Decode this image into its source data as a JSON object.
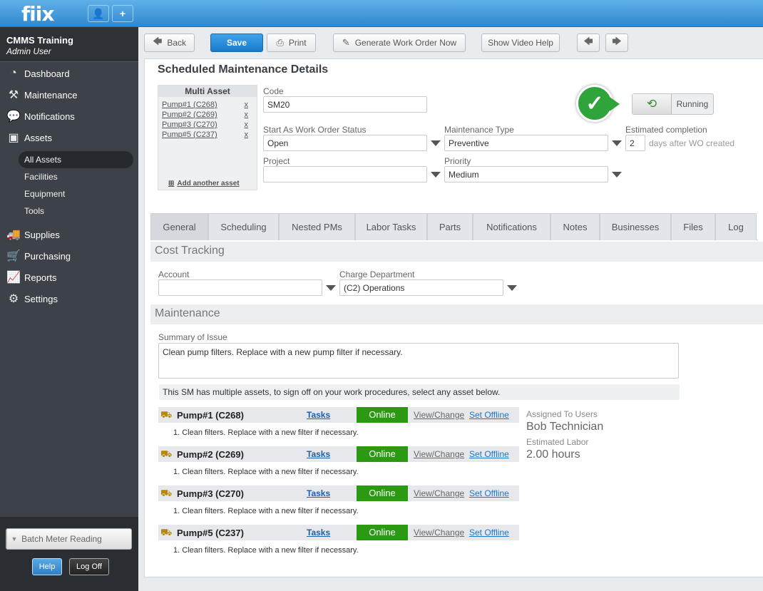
{
  "app": {
    "logo": "fiix"
  },
  "account": {
    "org": "CMMS Training",
    "user": "Admin User"
  },
  "nav": {
    "dashboard": "Dashboard",
    "maintenance": "Maintenance",
    "notifications": "Notifications",
    "assets": "Assets",
    "assets_sub": [
      "All Assets",
      "Facilities",
      "Equipment",
      "Tools"
    ],
    "supplies": "Supplies",
    "purchasing": "Purchasing",
    "reports": "Reports",
    "settings": "Settings"
  },
  "sidebar_bottom": {
    "batch": "Batch Meter Reading",
    "help": "Help",
    "logoff": "Log Off"
  },
  "toolbar": {
    "back": "Back",
    "save": "Save",
    "print": "Print",
    "generate": "Generate Work Order Now",
    "video": "Show Video Help"
  },
  "page": {
    "title": "Scheduled Maintenance Details"
  },
  "multi_asset": {
    "header": "Multi Asset",
    "items": [
      "Pump#1 (C268)",
      "Pump#2 (C269)",
      "Pump#3 (C270)",
      "Pump#5 (C237)"
    ],
    "remove": "x",
    "add": "Add another asset"
  },
  "form": {
    "code_label": "Code",
    "code": "SM20",
    "status_label": "Start As Work Order Status",
    "status": "Open",
    "mtype_label": "Maintenance Type",
    "mtype": "Preventive",
    "est_label": "Estimated completion",
    "est_value": "2",
    "est_suffix": "days after WO created",
    "project_label": "Project",
    "project": "",
    "priority_label": "Priority",
    "priority": "Medium"
  },
  "status": {
    "running": "Running",
    "color": "#2ea43b"
  },
  "tabs": [
    "General",
    "Scheduling",
    "Nested PMs",
    "Labor Tasks",
    "Parts",
    "Notifications",
    "Notes",
    "Businesses",
    "Files",
    "Log"
  ],
  "cost": {
    "heading": "Cost Tracking",
    "account_label": "Account",
    "account": "",
    "dept_label": "Charge Department",
    "dept": "(C2) Operations"
  },
  "maint": {
    "heading": "Maintenance",
    "summary_label": "Summary of Issue",
    "summary": "Clean pump filters. Replace with a new pump filter if necessary.",
    "note": "This SM has multiple assets, to sign off on your work procedures, select any asset below."
  },
  "assets": [
    {
      "name": "Pump#1 (C268)",
      "tasks": "Tasks",
      "status": "Online",
      "view": "View/Change",
      "offline": "Set Offline",
      "step": "1. Clean filters. Replace with a new filter if necessary."
    },
    {
      "name": "Pump#2 (C269)",
      "tasks": "Tasks",
      "status": "Online",
      "view": "View/Change",
      "offline": "Set Offline",
      "step": "1. Clean filters. Replace with a new filter if necessary."
    },
    {
      "name": "Pump#3 (C270)",
      "tasks": "Tasks",
      "status": "Online",
      "view": "View/Change",
      "offline": "Set Offline",
      "step": "1. Clean filters. Replace with a new filter if necessary."
    },
    {
      "name": "Pump#5 (C237)",
      "tasks": "Tasks",
      "status": "Online",
      "view": "View/Change",
      "offline": "Set Offline",
      "step": "1. Clean filters. Replace with a new filter if necessary."
    }
  ],
  "assigned": {
    "users_label": "Assigned To Users",
    "users": "Bob Technician",
    "labor_label": "Estimated Labor",
    "labor": "2.00 hours"
  }
}
